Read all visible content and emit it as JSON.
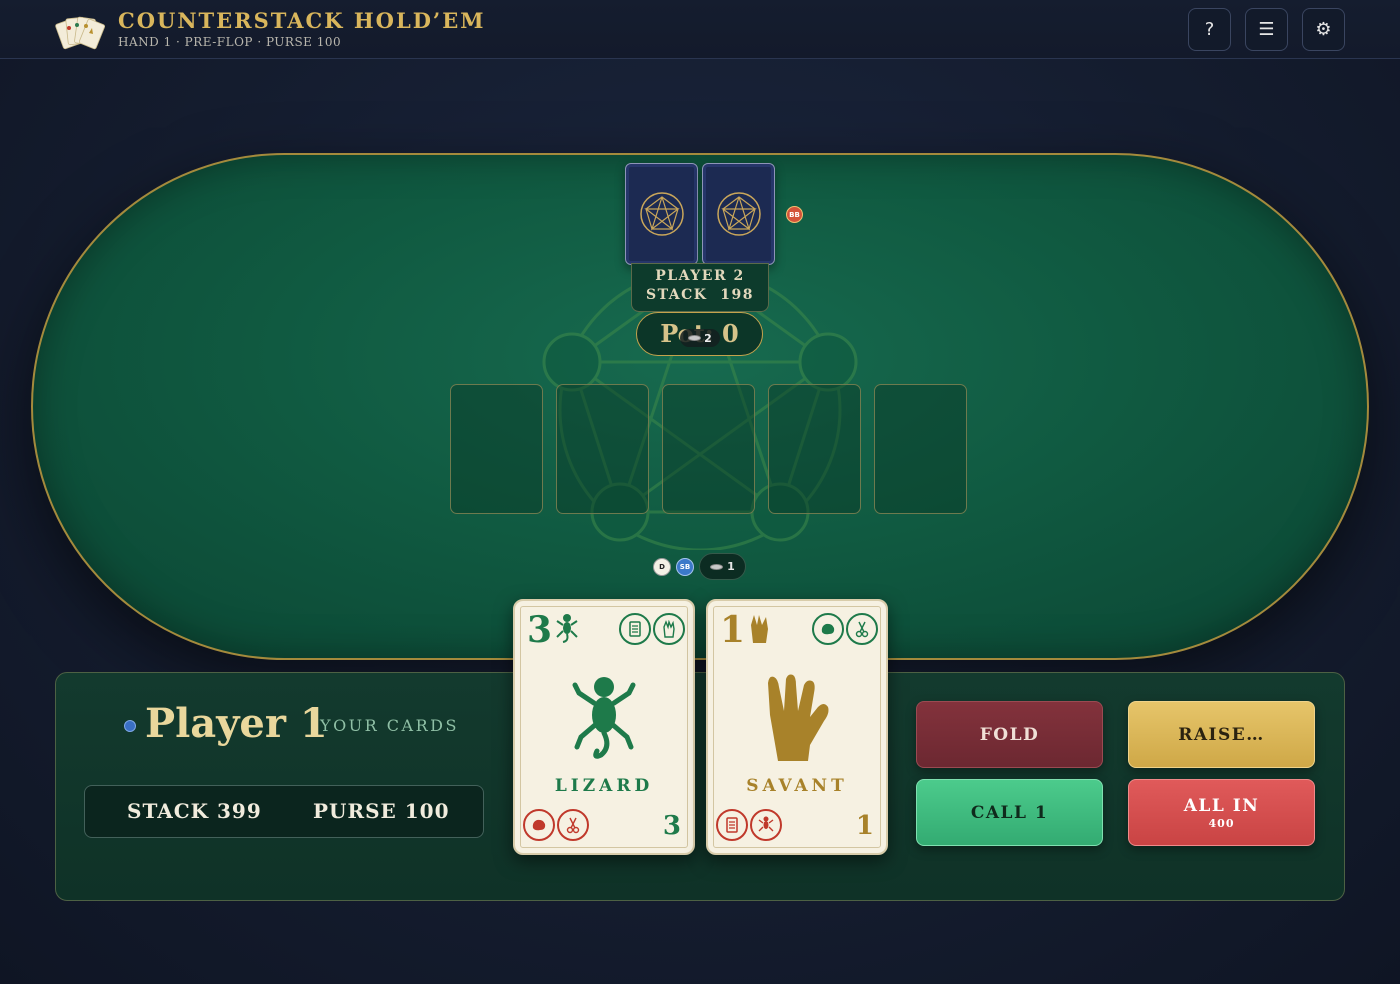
{
  "header": {
    "title": "COUNTERSTACK HOLD’EM",
    "subtitle": "HAND 1 · PRE-FLOP · PURSE 100",
    "help_label": "?",
    "menu_label": "☰",
    "settings_label": "⚙"
  },
  "opponent": {
    "name": "PLAYER 2",
    "stack_label": "STACK",
    "stack_value": "198",
    "badge": "BB",
    "cards_face_down": 2
  },
  "pot": {
    "label": "Pot: 0",
    "bet_amount": "2"
  },
  "community": {
    "slots": 5
  },
  "player": {
    "name": "Player 1",
    "your_cards_label": "YOUR CARDS",
    "dealer_badge": "D",
    "sb_badge": "SB",
    "bet_amount": "1",
    "stack_text": "STACK 399",
    "purse_text": "PURSE 100",
    "cards": [
      {
        "rank": "3",
        "name": "LIZARD",
        "color": "#1e7a4a",
        "icon": "lizard-icon",
        "beats": [
          "paper-icon",
          "spock-icon"
        ],
        "loses_to": [
          "rock-icon",
          "scissors-icon"
        ]
      },
      {
        "rank": "1",
        "name": "SAVANT",
        "color": "#a8822a",
        "icon": "spock-hand-icon",
        "beats": [
          "rock-icon",
          "scissors-icon"
        ],
        "loses_to": [
          "paper-icon",
          "lizard-icon"
        ]
      }
    ]
  },
  "actions": {
    "fold": "FOLD",
    "raise": "RAISE…",
    "call": "CALL 1",
    "all_in": "ALL IN",
    "all_in_amount": "400"
  },
  "colors": {
    "gold": "#d9b65c",
    "felt": "#105a41",
    "fold": "#7a2e36",
    "raise": "#d9b55a",
    "call": "#3dba7e",
    "all_in": "#d94b4b"
  }
}
